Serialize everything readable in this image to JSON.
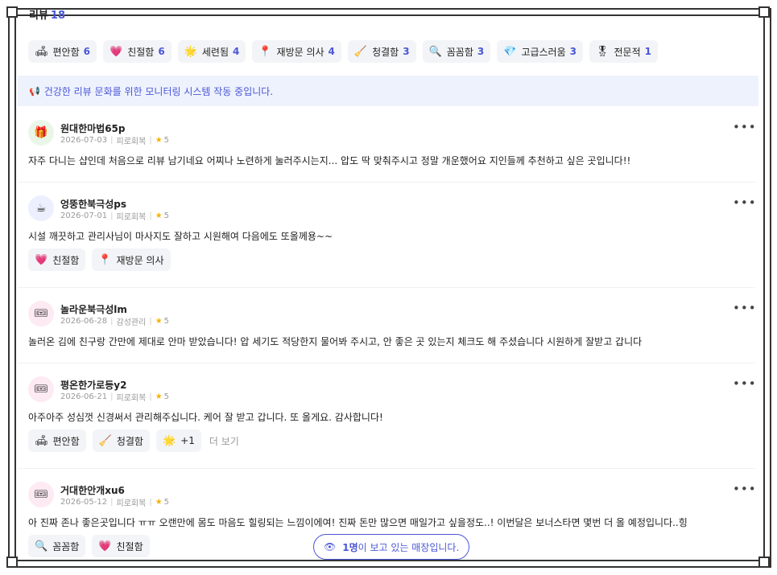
{
  "header": {
    "title": "리뷰",
    "count": "18"
  },
  "keywords": [
    {
      "icon": "🛋",
      "icon_name": "sofa-icon",
      "label": "편안함",
      "count": "6"
    },
    {
      "icon": "💗",
      "icon_name": "heart-icon",
      "label": "친절함",
      "count": "6"
    },
    {
      "icon": "🌟",
      "icon_name": "sparkle-icon",
      "label": "세련됨",
      "count": "4"
    },
    {
      "icon": "📍",
      "icon_name": "location-pin-icon",
      "label": "재방문 의사",
      "count": "4"
    },
    {
      "icon": "🧹",
      "icon_name": "broom-icon",
      "label": "청결함",
      "count": "3"
    },
    {
      "icon": "🔍",
      "icon_name": "magnifier-icon",
      "label": "꼼꼼함",
      "count": "3"
    },
    {
      "icon": "💎",
      "icon_name": "diamond-icon",
      "label": "고급스러움",
      "count": "3"
    },
    {
      "icon": "🎖",
      "icon_name": "medal-icon",
      "label": "전문적",
      "count": "1"
    }
  ],
  "notice": {
    "icon": "📢",
    "text": "건강한 리뷰 문화를 위한 모니터링 시스템 작동 중입니다."
  },
  "reviews": [
    {
      "avatar": "🎁",
      "avatar_bg": "#eaf7e8",
      "nickname": "원대한마법65p",
      "date": "2026-07-03",
      "category": "피로회복",
      "rating": "5",
      "text": "자주 다니는 샵인데 처음으로 리뷰 남기네요 어찌나 노련하게 눌러주시는지... 압도 딱 맞춰주시고 정말 개운했어요 지인들께 추천하고 싶은 곳입니다!!",
      "tags": []
    },
    {
      "avatar": "☕",
      "avatar_bg": "#eceffd",
      "nickname": "엉뚱한북극성ps",
      "date": "2026-07-01",
      "category": "피로회복",
      "rating": "5",
      "text": "시설 깨끗하고 관리사님이 마사지도 잘하고 시원해여 다음에도 또올께용~~",
      "tags": [
        {
          "icon": "💗",
          "icon_name": "heart-icon",
          "label": "친절함"
        },
        {
          "icon": "📍",
          "icon_name": "location-pin-icon",
          "label": "재방문 의사"
        }
      ]
    },
    {
      "avatar": "🎟",
      "avatar_bg": "#fdeaf3",
      "nickname": "놀라운북극성lm",
      "date": "2026-06-28",
      "category": "감성관리",
      "rating": "5",
      "text": "놀러온 김에 친구랑 간만에 제대로 안마 받았습니다! 압 세기도 적당한지 물어봐 주시고, 안 좋은 곳 있는지 체크도 해 주셨습니다 시원하게 잘받고 갑니다",
      "tags": []
    },
    {
      "avatar": "🎟",
      "avatar_bg": "#fdeaf3",
      "nickname": "평온한가로등y2",
      "date": "2026-06-21",
      "category": "피로회복",
      "rating": "5",
      "text": "아주아주 성심껏 신경써서 관리해주십니다. 케어 잘 받고 갑니다. 또 올게요. 감사합니다!",
      "tags": [
        {
          "icon": "🛋",
          "icon_name": "sofa-icon",
          "label": "편안함"
        },
        {
          "icon": "🧹",
          "icon_name": "broom-icon",
          "label": "청결함"
        },
        {
          "icon": "🌟",
          "icon_name": "sparkle-icon",
          "label": "+1"
        }
      ],
      "more_label": "더 보기"
    },
    {
      "avatar": "🎟",
      "avatar_bg": "#fdeaf3",
      "nickname": "거대한안개xu6",
      "date": "2026-05-12",
      "category": "피로회복",
      "rating": "5",
      "text": "아 진짜 존나 좋은곳입니다 ㅠㅠ 오랜만에 몸도 마음도 힐링되는 느낌이에여! 진짜 돈만 많으면 매일가고 싶을정도..! 이번달은 보너스타면 몇번 더 올 예정입니다..힝",
      "tags": [
        {
          "icon": "🔍",
          "icon_name": "magnifier-icon",
          "label": "꼼꼼함"
        },
        {
          "icon": "💗",
          "icon_name": "heart-icon",
          "label": "친절함"
        }
      ]
    }
  ],
  "viewers": {
    "icon": "👁",
    "count_text": "1명",
    "text": "이 보고 있는 매장입니다."
  },
  "more_menu_glyph": "•••",
  "star_glyph": "★",
  "separator": "|"
}
